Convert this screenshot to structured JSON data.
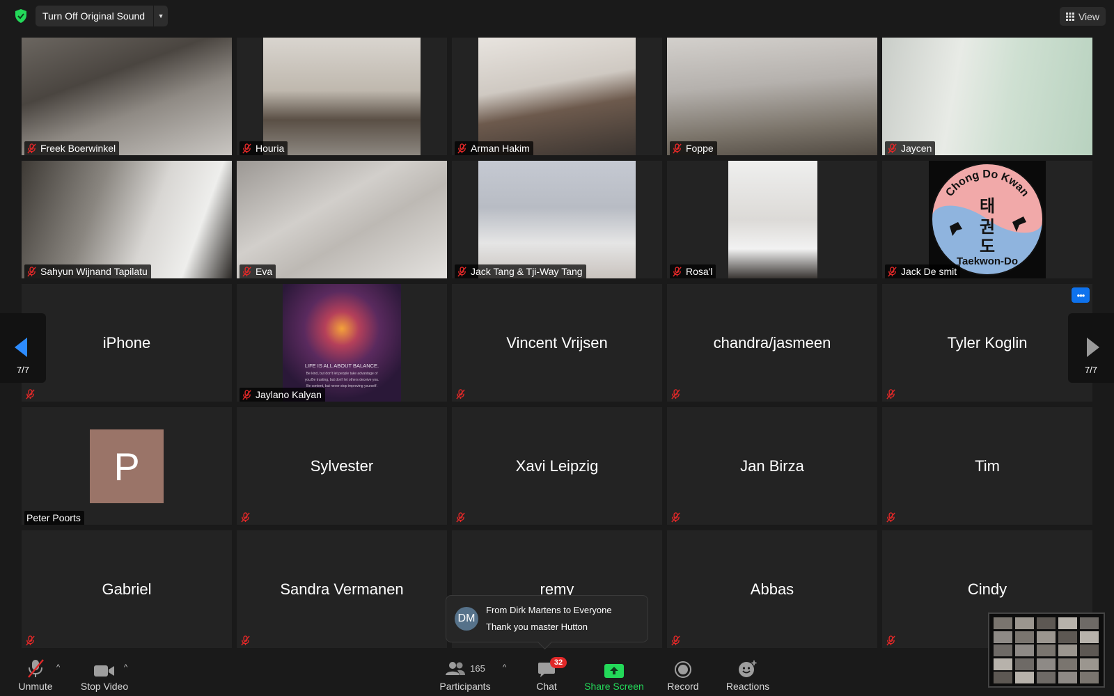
{
  "top_bar": {
    "original_sound_label": "Turn Off Original Sound",
    "view_label": "View"
  },
  "video_tiles": [
    {
      "name": "Freek Boerwinkel",
      "muted": true
    },
    {
      "name": "Houria",
      "muted": true
    },
    {
      "name": "Arman Hakim",
      "muted": true
    },
    {
      "name": "Foppe",
      "muted": true
    },
    {
      "name": "Jaycen",
      "muted": true
    },
    {
      "name": "Sahyun Wijnand Tapilatu",
      "muted": true
    },
    {
      "name": "Eva",
      "muted": true
    },
    {
      "name": "Jack Tang & Tji-Way Tang",
      "muted": true
    },
    {
      "name": "Rosa'l",
      "muted": true
    },
    {
      "name": "Jack De smit",
      "muted": true
    },
    {
      "name": "Jaylano Kalyan",
      "muted": true
    }
  ],
  "profile_logo": {
    "top_text": "Chong Do Kwan",
    "bottom_text": "Taekwon-Do",
    "hangul": [
      "태",
      "권",
      "도"
    ]
  },
  "poster_image": {
    "title": "LIFE IS ALL ABOUT BALANCE.",
    "line1": "Be kind, but don't let people take advantage of",
    "line2": "you.Be trusting, but don't let others deceive you.",
    "line3": "Be content, but never stop improving yourself."
  },
  "name_tiles": [
    {
      "name": "iPhone",
      "muted": true
    },
    {
      "name": "Vincent Vrijsen",
      "muted": true
    },
    {
      "name": "chandra/jasmeen",
      "muted": true
    },
    {
      "name": "Tyler Koglin",
      "muted": true
    },
    {
      "name": "Sylvester",
      "muted": true
    },
    {
      "name": "Xavi Leipzig",
      "muted": true
    },
    {
      "name": "Jan Birza",
      "muted": true
    },
    {
      "name": "Tim",
      "muted": true
    },
    {
      "name": "Gabriel",
      "muted": true
    },
    {
      "name": "Sandra Vermanen",
      "muted": true
    },
    {
      "name": "remy",
      "muted": false
    },
    {
      "name": "Abbas",
      "muted": true
    },
    {
      "name": "Cindy",
      "muted": true
    }
  ],
  "avatar_tile": {
    "name": "Peter Poorts",
    "initial": "P",
    "avatar_color": "#9a7468"
  },
  "pagination": {
    "left": "7/7",
    "right": "7/7"
  },
  "chat_notification": {
    "initials": "DM",
    "from": "From Dirk Martens to Everyone",
    "message": "Thank you master Hutton"
  },
  "toolbar": {
    "unmute": "Unmute",
    "stop_video": "Stop Video",
    "participants": "Participants",
    "participants_count": "165",
    "chat": "Chat",
    "chat_badge": "32",
    "share_screen": "Share Screen",
    "record": "Record",
    "reactions": "Reactions"
  },
  "colors": {
    "background": "#1a1a1a",
    "tile": "#232323",
    "share_green": "#23d959",
    "accent_blue": "#0e72ed",
    "mute_red": "#e02828"
  }
}
